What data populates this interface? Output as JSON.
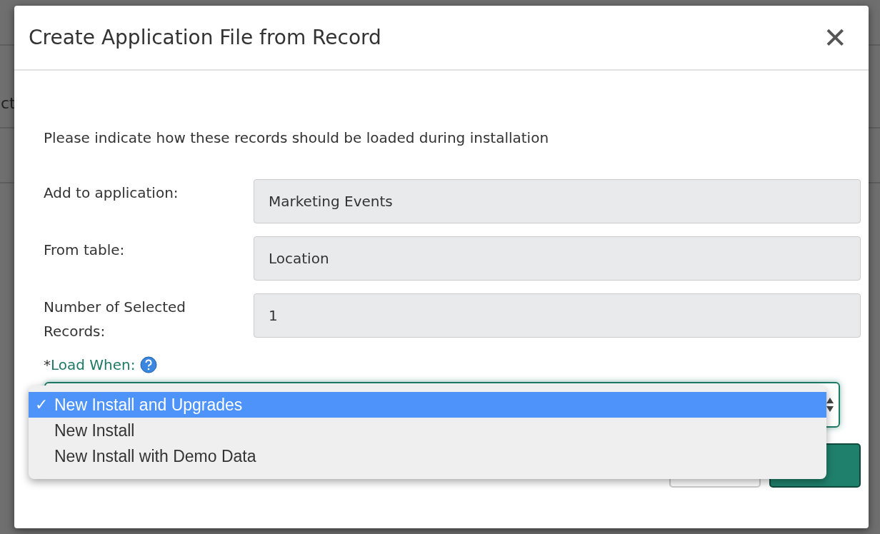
{
  "background": {
    "fragment": "ct"
  },
  "dialog": {
    "title": "Create Application File from Record",
    "close_label": "✕"
  },
  "intro": "Please indicate how these records should be loaded during installation",
  "fields": [
    {
      "label": "Add to application:",
      "value": "Marketing Events"
    },
    {
      "label": "From table:",
      "value": "Location"
    },
    {
      "label": "Number of Selected Records:",
      "value": "1"
    }
  ],
  "load_when": {
    "required_mark": "*",
    "check_mark": "✓",
    "label": "Load When:",
    "options": [
      {
        "label": "New Install and Upgrades",
        "selected": true
      },
      {
        "label": "New Install",
        "selected": false
      },
      {
        "label": "New Install with Demo Data",
        "selected": false
      }
    ]
  }
}
